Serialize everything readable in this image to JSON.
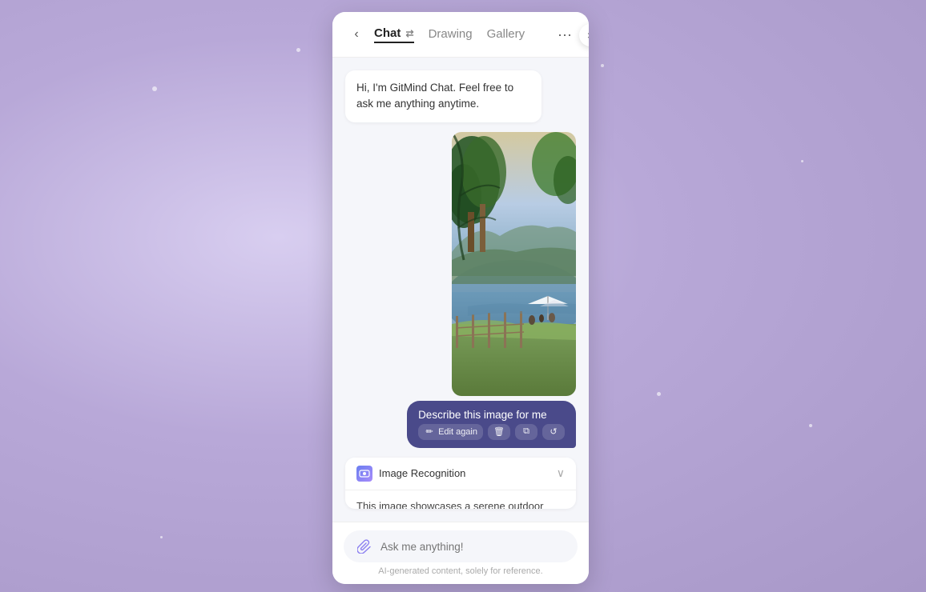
{
  "background": {
    "color": "#c5b8e8"
  },
  "close_button": {
    "label": "×"
  },
  "expand_button": {
    "label": "▶"
  },
  "header": {
    "back_label": "‹",
    "tabs": [
      {
        "id": "chat",
        "label": "Chat",
        "active": true
      },
      {
        "id": "drawing",
        "label": "Drawing",
        "active": false
      },
      {
        "id": "gallery",
        "label": "Gallery",
        "active": false
      }
    ],
    "more_label": "···",
    "tab_icon": "⇄"
  },
  "messages": {
    "greeting": "Hi, I'm GitMind Chat. Feel free to ask me anything anytime.",
    "user_prompt": "Describe this image for me",
    "edit_again_label": "Edit again",
    "ai_block": {
      "title": "Image Recognition",
      "body": "This image showcases a serene outdoor setting"
    }
  },
  "actions": {
    "delete_icon": "🗑",
    "copy_icon": "⧉",
    "refresh_icon": "↺"
  },
  "input": {
    "placeholder": "Ask me anything!",
    "disclaimer": "AI-generated content, solely for reference."
  }
}
